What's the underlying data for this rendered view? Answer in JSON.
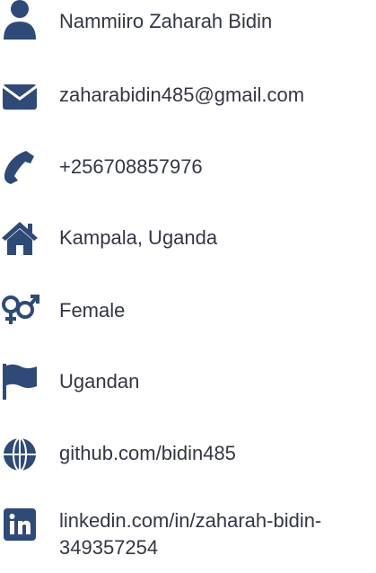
{
  "accent_color": "#2f4a77",
  "contact": {
    "name": {
      "icon": "person-icon",
      "text": "Nammiiro Zaharah Bidin"
    },
    "email": {
      "icon": "envelope-icon",
      "text": "zaharabidin485@gmail.com"
    },
    "phone": {
      "icon": "phone-icon",
      "text": "+256708857976"
    },
    "location": {
      "icon": "home-icon",
      "text": "Kampala, Uganda"
    },
    "gender": {
      "icon": "gender-icon",
      "text": "Female"
    },
    "nationality": {
      "icon": "flag-icon",
      "text": "Ugandan"
    },
    "github": {
      "icon": "globe-icon",
      "text": "github.com/bidin485"
    },
    "linkedin": {
      "icon": "linkedin-icon",
      "text": "linkedin.com/in/zaharah-bidin-349357254"
    }
  }
}
